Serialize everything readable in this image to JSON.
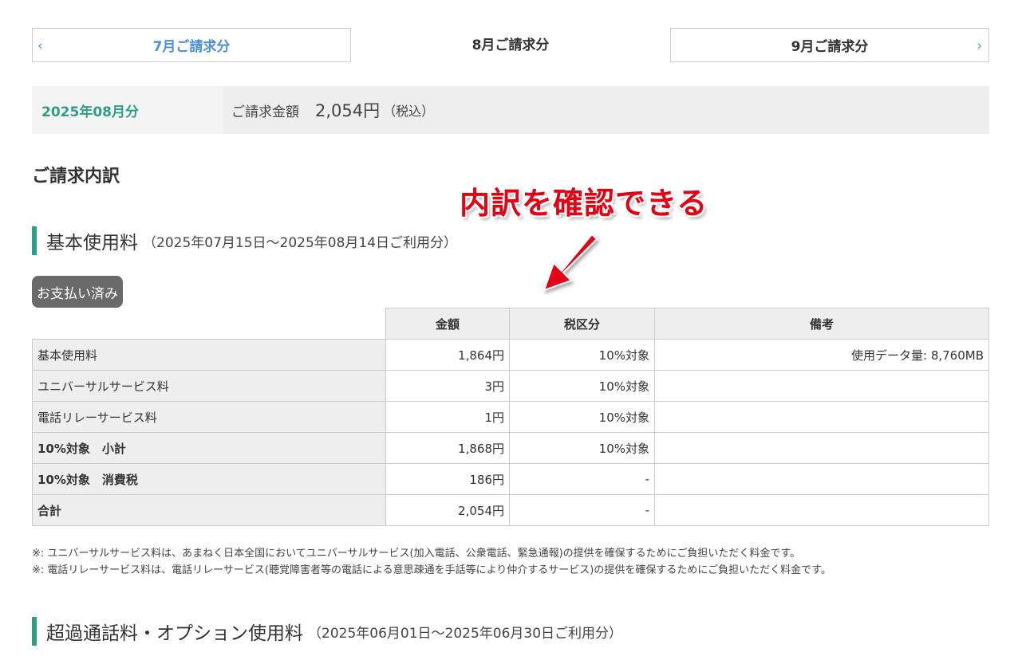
{
  "nav": {
    "prev_chevron": "‹",
    "prev_label": "7月ご請求分",
    "current_label": "8月ご請求分",
    "next_label": "9月ご請求分",
    "next_chevron": "›"
  },
  "summary": {
    "month": "2025年08月分",
    "amount_label": "ご請求金額",
    "amount_value": "2,054円",
    "tax_note": "（税込）"
  },
  "section_title": "ご請求内訳",
  "annotation": "内訳を確認できる",
  "basic": {
    "heading": "基本使用料",
    "period": "（2025年07月15日～2025年08月14日ご利用分）",
    "status_badge": "お支払い済み"
  },
  "table": {
    "headers": [
      "金額",
      "税区分",
      "備考"
    ],
    "rows": [
      {
        "label": "基本使用料",
        "amount": "1,864円",
        "tax": "10%対象",
        "note": "使用データ量: 8,760MB"
      },
      {
        "label": "ユニバーサルサービス料",
        "amount": "3円",
        "tax": "10%対象",
        "note": ""
      },
      {
        "label": "電話リレーサービス料",
        "amount": "1円",
        "tax": "10%対象",
        "note": ""
      },
      {
        "label": "10%対象　小計",
        "amount": "1,868円",
        "tax": "10%対象",
        "note": ""
      },
      {
        "label": "10%対象　消費税",
        "amount": "186円",
        "tax": "-",
        "note": ""
      },
      {
        "label": "合計",
        "amount": "2,054円",
        "tax": "-",
        "note": ""
      }
    ]
  },
  "notes": [
    "※: ユニバーサルサービス料は、あまねく日本全国においてユニバーサルサービス(加入電話、公衆電話、緊急通報)の提供を確保するためにご負担いただく料金です。",
    "※: 電話リレーサービス料は、電話リレーサービス(聴覚障害者等の電話による意思疎通を手話等により仲介するサービス)の提供を確保するためにご負担いただく料金です。"
  ],
  "overage": {
    "heading": "超過通話料・オプション使用料",
    "period": "（2025年06月01日～2025年06月30日ご利用分）"
  },
  "colors": {
    "accent_green": "#2e9e86",
    "link_blue": "#4a90d9",
    "annotation_red": "#e60012",
    "badge_gray": "#6a6a6a"
  }
}
